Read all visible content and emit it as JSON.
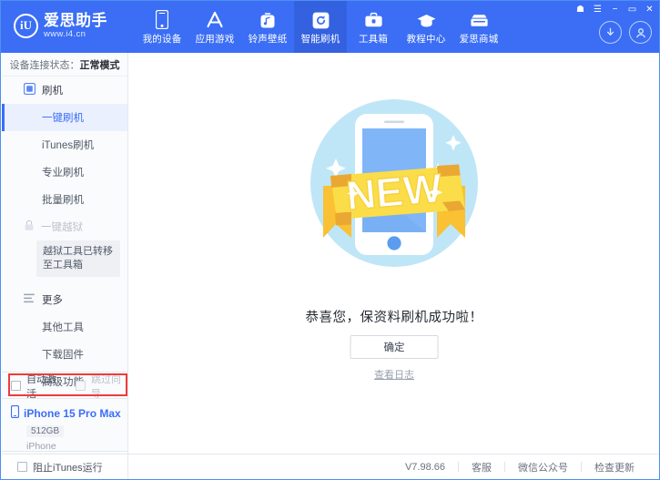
{
  "window": {
    "controls": [
      {
        "name": "skin-icon",
        "glyph": "☗"
      },
      {
        "name": "menu-icon",
        "glyph": "☰"
      },
      {
        "name": "minimize-icon",
        "glyph": "−"
      },
      {
        "name": "maximize-icon",
        "glyph": "▭"
      },
      {
        "name": "close-icon",
        "glyph": "✕"
      }
    ]
  },
  "header": {
    "logo_mark": "iU",
    "logo_cn": "爱思助手",
    "logo_url": "www.i4.cn",
    "accent": "#3b6ef5",
    "active_tab_bg": "#3461e0",
    "tabs": [
      {
        "label": "我的设备",
        "icon": "phone-icon",
        "active": false
      },
      {
        "label": "应用游戏",
        "icon": "appstore-icon",
        "active": false
      },
      {
        "label": "铃声壁纸",
        "icon": "music-icon",
        "active": false
      },
      {
        "label": "智能刷机",
        "icon": "refresh-icon",
        "active": true
      },
      {
        "label": "工具箱",
        "icon": "toolbox-icon",
        "active": false
      },
      {
        "label": "教程中心",
        "icon": "graduation-cap-icon",
        "active": false
      },
      {
        "label": "爱思商城",
        "icon": "store-icon",
        "active": false
      }
    ],
    "right_icons": [
      {
        "name": "download-icon"
      },
      {
        "name": "user-account-icon"
      }
    ]
  },
  "sidebar": {
    "status_label": "设备连接状态：",
    "status_value": "正常模式",
    "group_flash": "刷机",
    "items_flash": [
      {
        "label": "一键刷机",
        "active": true
      },
      {
        "label": "iTunes刷机",
        "active": false
      },
      {
        "label": "专业刷机",
        "active": false
      },
      {
        "label": "批量刷机",
        "active": false
      }
    ],
    "group_jailbreak": "一键越狱",
    "jailbreak_tip": "越狱工具已转移至工具箱",
    "group_more": "更多",
    "items_more": [
      {
        "label": "其他工具",
        "active": false
      },
      {
        "label": "下载固件",
        "active": false
      },
      {
        "label": "高级功能",
        "active": false
      }
    ],
    "checkbox_auto_activate": "自动激活",
    "checkbox_skip_wizard": "跳过向导",
    "highlight_color": "#ef3b3b",
    "device_name": "iPhone 15 Pro Max",
    "device_capacity": "512GB",
    "device_type": "iPhone"
  },
  "main": {
    "illustration": "new-badge-phone-illustration",
    "success_text": "恭喜您，保资料刷机成功啦！",
    "confirm_button": "确定",
    "view_log_link": "查看日志"
  },
  "footer": {
    "block_itunes": "阻止iTunes运行",
    "version": "V7.98.66",
    "links": [
      "客服",
      "微信公众号",
      "检查更新"
    ]
  }
}
